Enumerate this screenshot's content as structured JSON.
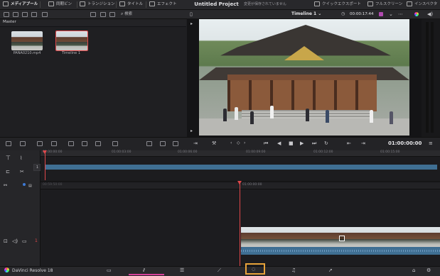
{
  "topbar": {
    "media_pool": "メディアプール",
    "sync_bin": "同期ビン",
    "transitions": "トランジション",
    "titles": "タイトル",
    "effects": "エフェクト",
    "project_title": "Untitled Project",
    "unsaved": "変更が保存されていません",
    "quick_export": "クイックエクスポート",
    "fullscreen": "フルスクリーン",
    "inspector": "インスペクタ"
  },
  "subtoolbar": {
    "search": "検索",
    "timeline_name": "Timeline 1",
    "timecode": "00:00:17:44"
  },
  "media_pool": {
    "bin": "Master",
    "clips": [
      {
        "name": "PANA0210.mp4"
      },
      {
        "name": "Timeline 1"
      }
    ]
  },
  "viewer": {
    "timecode": "01:00:00:00"
  },
  "upper_timeline": {
    "ruler": [
      "01:00:00:00",
      "01:00:03:00",
      "01:00:06:00",
      "01:00:09:00",
      "01:00:12:00",
      "01:00:15:00"
    ],
    "track": "1"
  },
  "lower_timeline": {
    "ruler_left": "00:59:50:00",
    "ruler_center": "01:00:00:00",
    "track": "1"
  },
  "bottombar": {
    "app": "DaVinci Resolve 18",
    "active_page": "cut",
    "highlight": "#e7a33a"
  }
}
